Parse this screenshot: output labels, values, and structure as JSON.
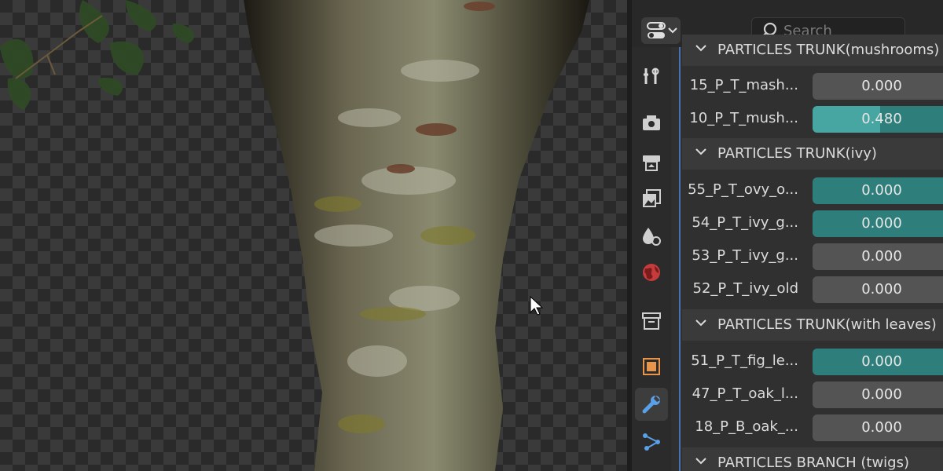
{
  "search": {
    "placeholder": "Search"
  },
  "sections": [
    {
      "title": "PARTICLES TRUNK(mushrooms)",
      "rows": [
        {
          "label": "15_P_T_mash...",
          "value": "0.000",
          "fraction": 0,
          "style": "gray"
        },
        {
          "label": "10_P_T_mush...",
          "value": "0.480",
          "fraction": 0.48,
          "style": "teal"
        }
      ]
    },
    {
      "title": "PARTICLES TRUNK(ivy)",
      "rows": [
        {
          "label": "55_P_T_ovy_o...",
          "value": "0.000",
          "fraction": 0,
          "style": "teal"
        },
        {
          "label": "54_P_T_ivy_g...",
          "value": "0.000",
          "fraction": 0,
          "style": "teal"
        },
        {
          "label": "53_P_T_ivy_g...",
          "value": "0.000",
          "fraction": 0,
          "style": "gray"
        },
        {
          "label": "52_P_T_ivy_old",
          "value": "0.000",
          "fraction": 0,
          "style": "gray"
        }
      ]
    },
    {
      "title": "PARTICLES TRUNK(with leaves)",
      "rows": [
        {
          "label": "51_P_T_fig_le...",
          "value": "0.000",
          "fraction": 0,
          "style": "teal"
        },
        {
          "label": "47_P_T_oak_l...",
          "value": "0.000",
          "fraction": 0,
          "style": "gray"
        },
        {
          "label": "18_P_B_oak_...",
          "value": "0.000",
          "fraction": 0,
          "style": "gray"
        }
      ]
    },
    {
      "title": "PARTICLES BRANCH (twigs)",
      "rows": []
    }
  ],
  "tabs": [
    {
      "icon": "tool-icon",
      "active": false
    },
    {
      "icon": "render-icon",
      "active": false
    },
    {
      "icon": "output-icon",
      "active": false
    },
    {
      "icon": "view-layer-icon",
      "active": false
    },
    {
      "icon": "scene-icon",
      "active": false
    },
    {
      "icon": "world-icon",
      "active": false
    },
    {
      "icon": "collection-icon",
      "active": false
    },
    {
      "icon": "object-icon",
      "active": false
    },
    {
      "icon": "modifier-wrench-icon",
      "active": true
    },
    {
      "icon": "particles-icon",
      "active": false
    }
  ],
  "colors": {
    "accent": "#4772b3",
    "slider_teal": "#2e7f7c",
    "slider_fill": "#47a5a2",
    "slider_gray": "#545454"
  }
}
